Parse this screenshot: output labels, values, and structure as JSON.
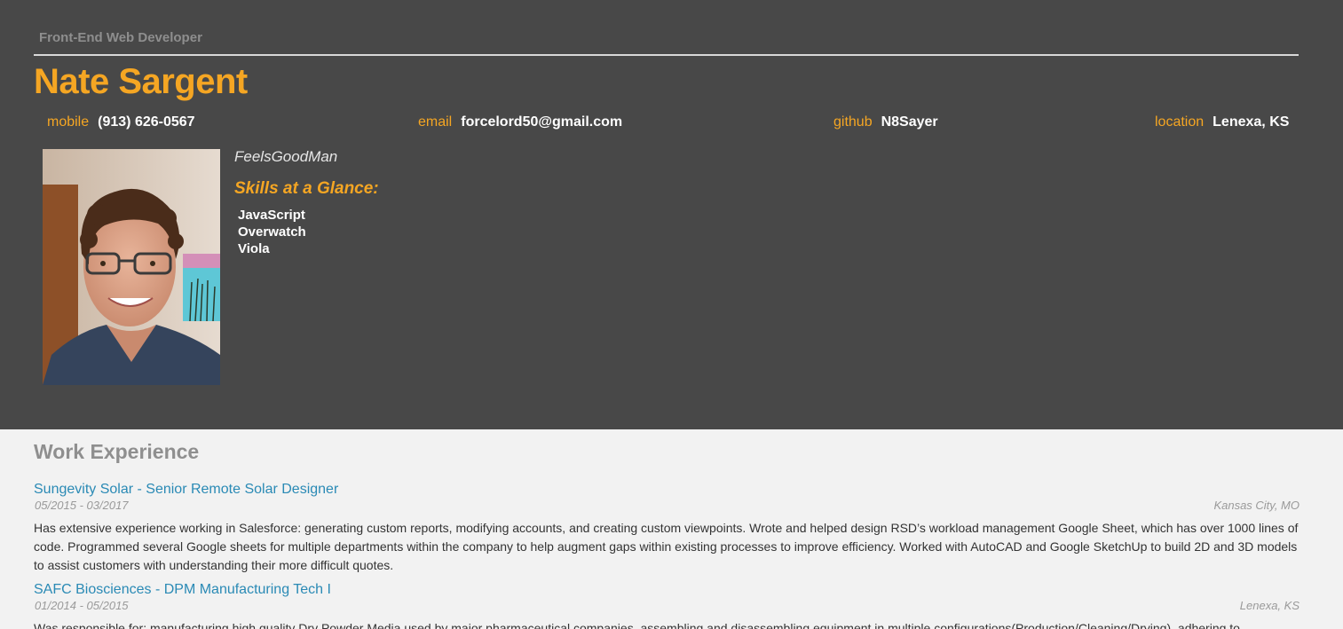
{
  "header": {
    "role": "Front-End Web Developer",
    "name": "Nate Sargent",
    "contacts": [
      {
        "label": "mobile",
        "value": "(913) 626-0567"
      },
      {
        "label": "email",
        "value": "forcelord50@gmail.com"
      },
      {
        "label": "github",
        "value": "N8Sayer"
      },
      {
        "label": "location",
        "value": "Lenexa, KS"
      }
    ],
    "tagline": "FeelsGoodMan",
    "skills_title": "Skills at a Glance:",
    "skills": [
      "JavaScript",
      "Overwatch",
      "Viola"
    ]
  },
  "work": {
    "title": "Work Experience",
    "jobs": [
      {
        "title": "Sungevity Solar - Senior Remote Solar Designer",
        "dates": "05/2015 - 03/2017",
        "location": "Kansas City, MO",
        "description": "Has extensive experience working in Salesforce: generating custom reports, modifying accounts, and creating custom viewpoints. Wrote and helped design RSD’s workload management Google Sheet, which has over 1000 lines of code. Programmed several Google sheets for multiple departments within the company to help augment gaps within existing processes to improve efficiency. Worked with AutoCAD and Google SketchUp to build 2D and 3D models to assist customers with understanding their more difficult quotes."
      },
      {
        "title": "SAFC Biosciences - DPM Manufacturing Tech I",
        "dates": "01/2014 - 05/2015",
        "location": "Lenexa, KS",
        "description": "Was responsible for: manufacturing high quality Dry Powder Media used by major pharmaceutical companies, assembling and disassembling equipment in multiple configurations(Production/Cleaning/Drying), adhering to"
      }
    ]
  },
  "colors": {
    "header_bg": "#484848",
    "accent": "#f5a623",
    "link": "#2a8ab5",
    "page_bg": "#f2f2f2"
  }
}
